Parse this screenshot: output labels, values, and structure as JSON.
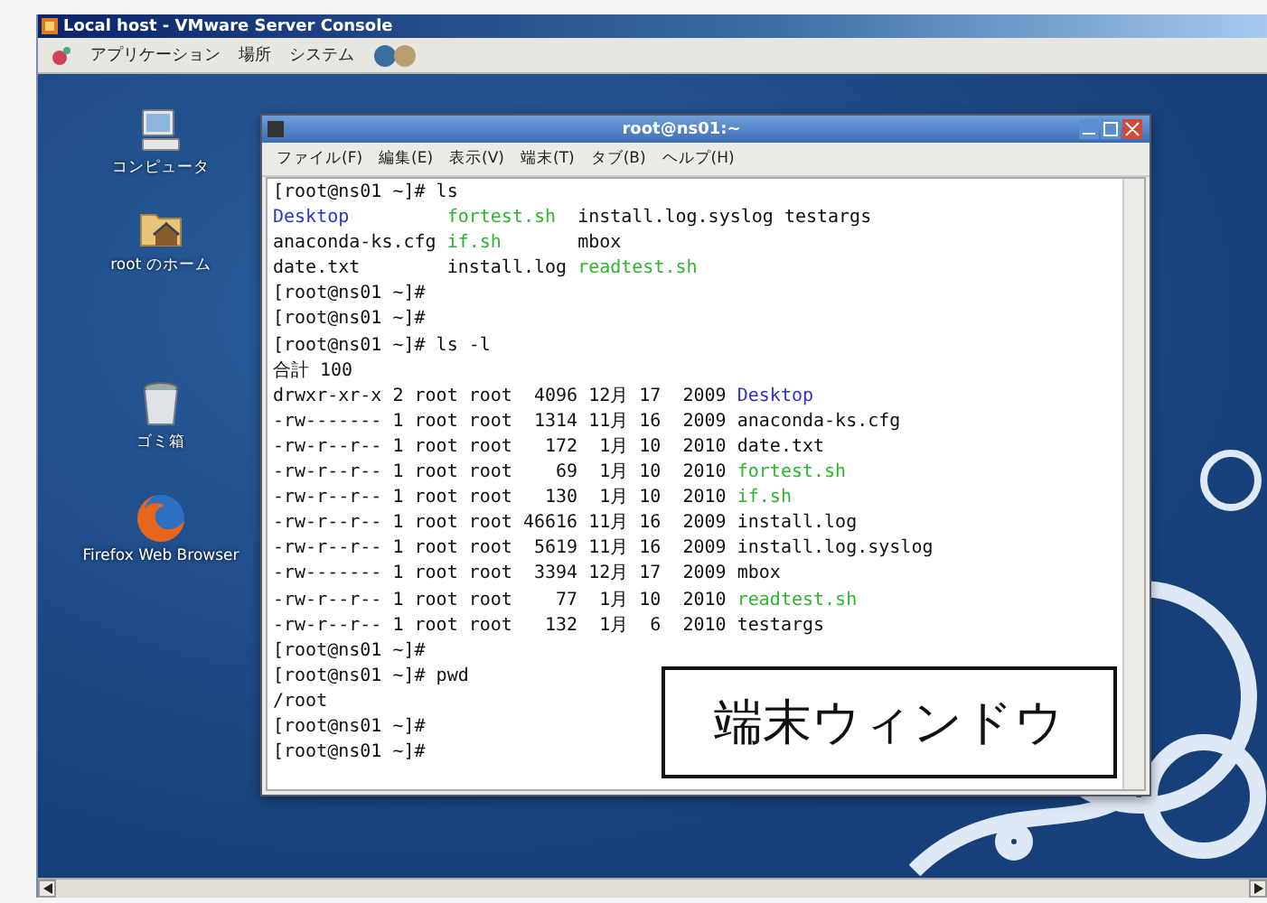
{
  "vm_window": {
    "title": "Local host - VMware Server Console"
  },
  "top_panel": {
    "menus": [
      "アプリケーション",
      "場所",
      "システム"
    ]
  },
  "desktop_icons": [
    {
      "label": "コンピュータ",
      "kind": "computer"
    },
    {
      "label": "root のホーム",
      "kind": "home"
    },
    {
      "label": "ゴミ箱",
      "kind": "trash"
    },
    {
      "label": "Firefox Web Browser",
      "kind": "browser"
    }
  ],
  "terminal": {
    "title": "root@ns01:~",
    "menu": [
      "ファイル(F)",
      "編集(E)",
      "表示(V)",
      "端末(T)",
      "タブ(B)",
      "ヘルプ(H)"
    ],
    "lines": [
      {
        "kind": "prompt",
        "text": "[root@ns01 ~]# ls"
      },
      {
        "kind": "columns",
        "entries": [
          {
            "name": "Desktop",
            "color": "#2d35c8"
          },
          {
            "name": "fortest.sh",
            "color": "#2fb52f"
          },
          {
            "name": "install.log.syslog",
            "color": "#111111"
          },
          {
            "name": "testargs",
            "color": "#111111"
          }
        ]
      },
      {
        "kind": "columns",
        "entries": [
          {
            "name": "anaconda-ks.cfg",
            "color": "#111111"
          },
          {
            "name": "if.sh",
            "color": "#2fb52f"
          },
          {
            "name": "mbox",
            "color": "#111111"
          }
        ]
      },
      {
        "kind": "columns",
        "entries": [
          {
            "name": "date.txt",
            "color": "#111111"
          },
          {
            "name": "install.log",
            "color": "#111111"
          },
          {
            "name": "readtest.sh",
            "color": "#2fb52f"
          }
        ]
      },
      {
        "kind": "prompt",
        "text": "[root@ns01 ~]#"
      },
      {
        "kind": "prompt",
        "text": "[root@ns01 ~]#"
      },
      {
        "kind": "prompt",
        "text": "[root@ns01 ~]# ls -l"
      },
      {
        "kind": "output",
        "text": "合計 100"
      },
      {
        "kind": "long",
        "info": "drwxr-xr-x 2 root root  4096 12月 17  2009",
        "name": "Desktop",
        "color": "#2d35c8"
      },
      {
        "kind": "long",
        "info": "-rw------- 1 root root  1314 11月 16  2009",
        "name": "anaconda-ks.cfg",
        "color": "#111111"
      },
      {
        "kind": "long",
        "info": "-rw-r--r-- 1 root root   172  1月 10  2010",
        "name": "date.txt",
        "color": "#111111"
      },
      {
        "kind": "long",
        "info": "-rw-r--r-- 1 root root    69  1月 10  2010",
        "name": "fortest.sh",
        "color": "#2fb52f"
      },
      {
        "kind": "long",
        "info": "-rw-r--r-- 1 root root   130  1月 10  2010",
        "name": "if.sh",
        "color": "#2fb52f"
      },
      {
        "kind": "long",
        "info": "-rw-r--r-- 1 root root 46616 11月 16  2009",
        "name": "install.log",
        "color": "#111111"
      },
      {
        "kind": "long",
        "info": "-rw-r--r-- 1 root root  5619 11月 16  2009",
        "name": "install.log.syslog",
        "color": "#111111"
      },
      {
        "kind": "long",
        "info": "-rw------- 1 root root  3394 12月 17  2009",
        "name": "mbox",
        "color": "#111111"
      },
      {
        "kind": "long",
        "info": "-rw-r--r-- 1 root root    77  1月 10  2010",
        "name": "readtest.sh",
        "color": "#2fb52f"
      },
      {
        "kind": "long",
        "info": "-rw-r--r-- 1 root root   132  1月  6  2010",
        "name": "testargs",
        "color": "#111111"
      },
      {
        "kind": "prompt",
        "text": "[root@ns01 ~]#"
      },
      {
        "kind": "prompt",
        "text": "[root@ns01 ~]# pwd"
      },
      {
        "kind": "output",
        "text": "/root"
      },
      {
        "kind": "prompt",
        "text": "[root@ns01 ~]#"
      },
      {
        "kind": "prompt",
        "text": "[root@ns01 ~]#"
      }
    ]
  },
  "caption": "端末ウィンドウ"
}
